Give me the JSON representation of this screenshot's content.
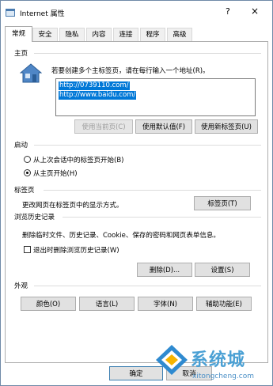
{
  "window": {
    "title": "Internet 属性",
    "help": "?",
    "close": "×"
  },
  "tabs": [
    "常规",
    "安全",
    "隐私",
    "内容",
    "连接",
    "程序",
    "高级"
  ],
  "home": {
    "group_label": "主页",
    "description": "若要创建多个主标签页，请在每行输入一个地址(R)。",
    "urls": [
      "http://0739110.com/",
      "http://www.baidu.com/"
    ],
    "buttons": {
      "use_current": "使用当前页(C)",
      "use_default": "使用默认值(F)",
      "use_new_tab": "使用新标签页(U)"
    }
  },
  "startup": {
    "group_label": "启动",
    "options": [
      "从上次会话中的标签页开始(B)",
      "从主页开始(H)"
    ],
    "selected_index": 1
  },
  "tabs_section": {
    "group_label": "标签页",
    "description": "更改网页在标签页中的显示方式。",
    "button": "标签页(T)"
  },
  "history": {
    "group_label": "浏览历史记录",
    "description": "删除临时文件、历史记录、Cookie、保存的密码和网页表单信息。",
    "checkbox": "退出时删除浏览历史记录(W)",
    "checkbox_checked": false,
    "delete_button": "删除(D)...",
    "settings_button": "设置(S)"
  },
  "appearance": {
    "group_label": "外观",
    "buttons": [
      "颜色(O)",
      "语言(L)",
      "字体(N)",
      "辅助功能(E)"
    ]
  },
  "footer": {
    "ok": "确定",
    "cancel": "取消"
  },
  "watermark": {
    "text": "系统城",
    "url": "xitongcheng.com"
  }
}
